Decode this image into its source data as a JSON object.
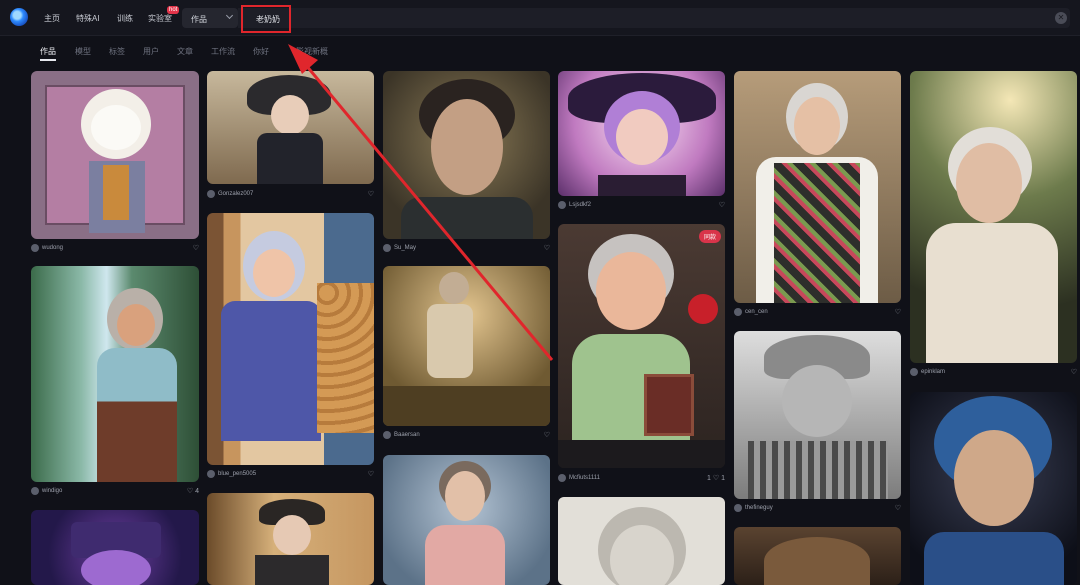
{
  "topbar": {
    "nav": [
      "主页",
      "特殊AI",
      "训练",
      "实验室"
    ],
    "hot_badge": "hot",
    "search_type": "作品",
    "search_query": "老奶奶"
  },
  "tabs": [
    "作品",
    "模型",
    "标签",
    "用户",
    "文章",
    "工作流",
    "你好",
    "影视新概"
  ],
  "cards": [
    {
      "user": "wudong",
      "actions": "♡"
    },
    {
      "user": "Gonzalez007",
      "actions": "♡"
    },
    {
      "user": "Su_May",
      "actions": "♡"
    },
    {
      "user": "Lsjsdkf2",
      "actions": "♡"
    },
    {
      "user": "cen_cen",
      "actions": "♡"
    },
    {
      "user": "epinklam",
      "actions": "♡"
    },
    {
      "user": "windigo",
      "actions": "♡ 4"
    },
    {
      "user": "blue_pen5005",
      "actions": "♡"
    },
    {
      "user": "Baaersan",
      "actions": "♡"
    },
    {
      "user": "Mcfiuts1111",
      "actions": "1 ♡ 1"
    },
    {
      "user": "thefineguy",
      "actions": "♡"
    }
  ],
  "badge_remix": "同款",
  "colors": {
    "accent": "#e0262c",
    "background": "#101118"
  }
}
